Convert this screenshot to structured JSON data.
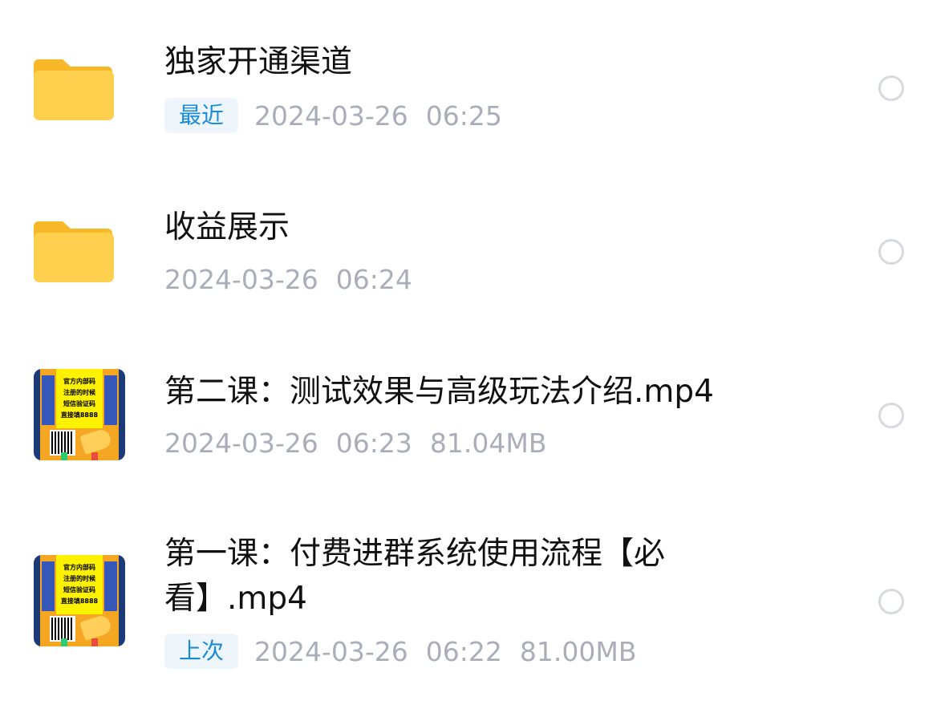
{
  "files": [
    {
      "type": "folder",
      "icon": "folder-icon",
      "name": "独家开通渠道",
      "tag": "最近",
      "date": "2024-03-26",
      "time": "06:25",
      "size": ""
    },
    {
      "type": "folder",
      "icon": "folder-icon",
      "name": "收益展示",
      "tag": "",
      "date": "2024-03-26",
      "time": "06:24",
      "size": ""
    },
    {
      "type": "video",
      "icon": "video-thumbnail",
      "name": "第二课：测试效果与高级玩法介绍.mp4",
      "tag": "",
      "date": "2024-03-26",
      "time": "06:23",
      "size": "81.04MB",
      "thumb_lines": [
        "官方内部码",
        "注册的时候",
        "短信验证码",
        "直接填8888"
      ]
    },
    {
      "type": "video",
      "icon": "video-thumbnail",
      "name": "第一课：付费进群系统使用流程【必看】.mp4",
      "tag": "上次",
      "date": "2024-03-26",
      "time": "06:22",
      "size": "81.00MB",
      "thumb_lines": [
        "官方内部码",
        "注册的时候",
        "短信验证码",
        "直接填8888"
      ]
    }
  ],
  "colors": {
    "folder": "#ffc93c",
    "tag_text": "#1a8cd8",
    "tag_bg": "#eef5fb",
    "meta_text": "#a9aeb9",
    "radio_border": "#d6d9de"
  }
}
